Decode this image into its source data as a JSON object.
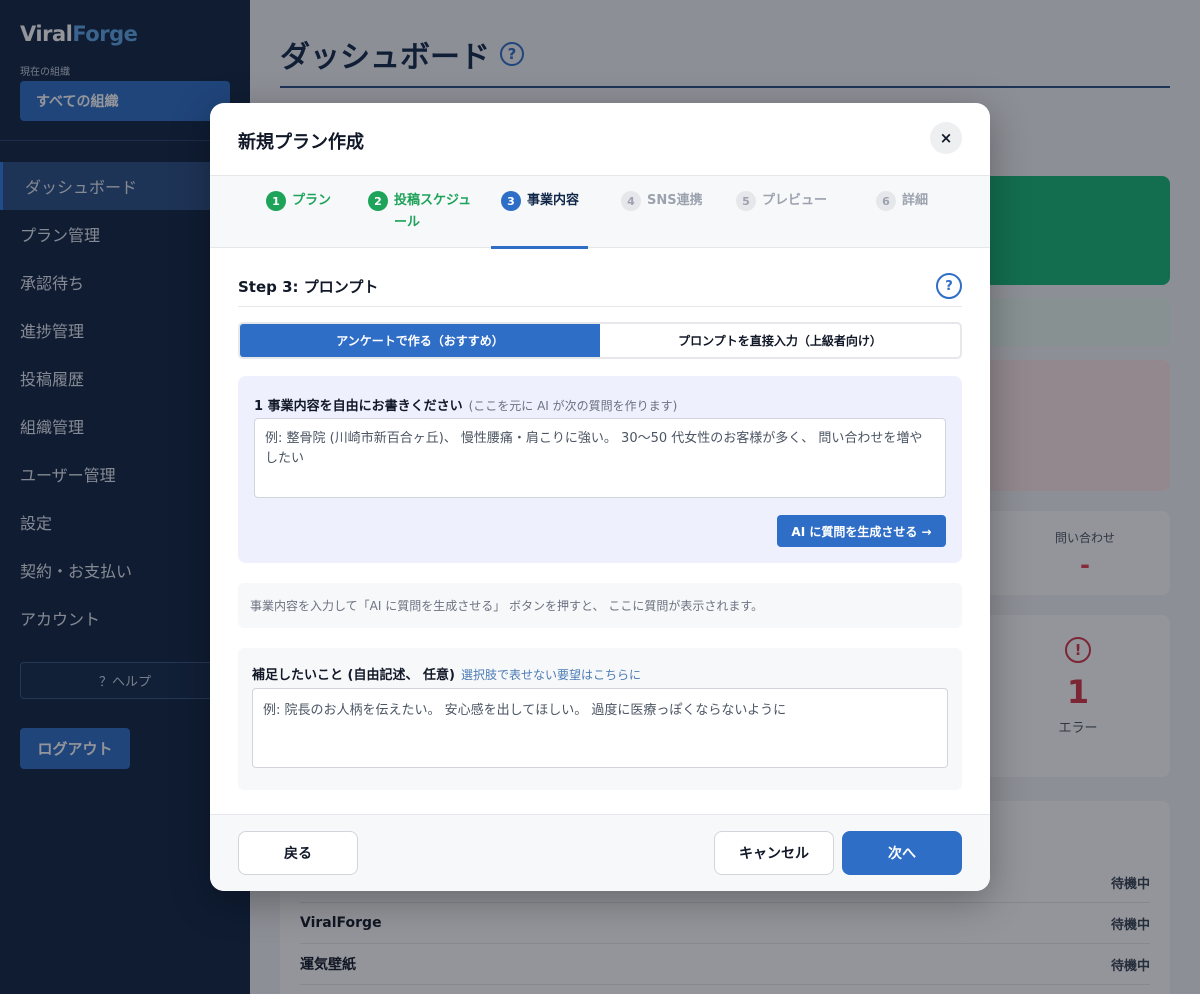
{
  "sidebar": {
    "brand_part1": "Viral",
    "brand_part2": "Forge",
    "org_label": "現在の組織",
    "org_selected": "すべての組織",
    "items": [
      {
        "label": "ダッシュボード"
      },
      {
        "label": "プラン管理"
      },
      {
        "label": "承認待ち"
      },
      {
        "label": "進捗管理"
      },
      {
        "label": "投稿履歴"
      },
      {
        "label": "組織管理"
      },
      {
        "label": "ユーザー管理"
      },
      {
        "label": "設定"
      },
      {
        "label": "契約・お支払い"
      },
      {
        "label": "アカウント"
      }
    ],
    "help_label": "？ヘルプ",
    "logout_label": "ログアウト"
  },
  "main": {
    "title": "ダッシュボード",
    "help_glyph": "?",
    "stat_label": "問い合わせ",
    "stat_value": "-",
    "error_value": "1",
    "error_label": "エラー",
    "list_rows": [
      {
        "name": "",
        "status": "待機中"
      },
      {
        "name": "ViralForge",
        "status": "待機中"
      },
      {
        "name": "運気壁紙",
        "status": "待機中"
      }
    ]
  },
  "modal": {
    "title": "新規プラン作成",
    "close_glyph": "×",
    "steps": [
      {
        "num": "1",
        "label": "プラン",
        "state": "done"
      },
      {
        "num": "2",
        "label": "投稿スケジュール",
        "state": "done"
      },
      {
        "num": "3",
        "label": "事業内容",
        "state": "current"
      },
      {
        "num": "4",
        "label": "SNS連携",
        "state": "todo"
      },
      {
        "num": "5",
        "label": "プレビュー",
        "state": "todo"
      },
      {
        "num": "6",
        "label": "詳細",
        "state": "todo"
      }
    ],
    "section_title": "Step 3: プロンプト",
    "section_help": "?",
    "seg_survey": "アンケートで作る（おすすめ）",
    "seg_direct": "プロンプトを直接入力（上級者向け）",
    "survey_label": "1 事業内容を自由にお書きください",
    "survey_hint": "(ここを元に AI が次の質問を作ります)",
    "survey_placeholder": "例: 整骨院 (川崎市新百合ヶ丘)、 慢性腰痛・肩こりに強い。 30〜50 代女性のお客様が多く、 問い合わせを増やしたい",
    "generate_label": "AI に質問を生成させる →",
    "info_text": "事業内容を入力して「AI に質問を生成させる」 ボタンを押すと、 ここに質問が表示されます。",
    "extra_label": "補足したいこと (自由記述、 任意)",
    "extra_hint": "選択肢で表せない要望はこちらに",
    "extra_placeholder": "例: 院長のお人柄を伝えたい。 安心感を出してほしい。 過度に医療っぽくならないように",
    "back_label": "戻る",
    "cancel_label": "キャンセル",
    "next_label": "次へ"
  },
  "colors": {
    "accent": "#2f6ec7",
    "sidebar_bg": "#0f2342",
    "done_green": "#1ea35a",
    "error_red": "#d63547"
  }
}
